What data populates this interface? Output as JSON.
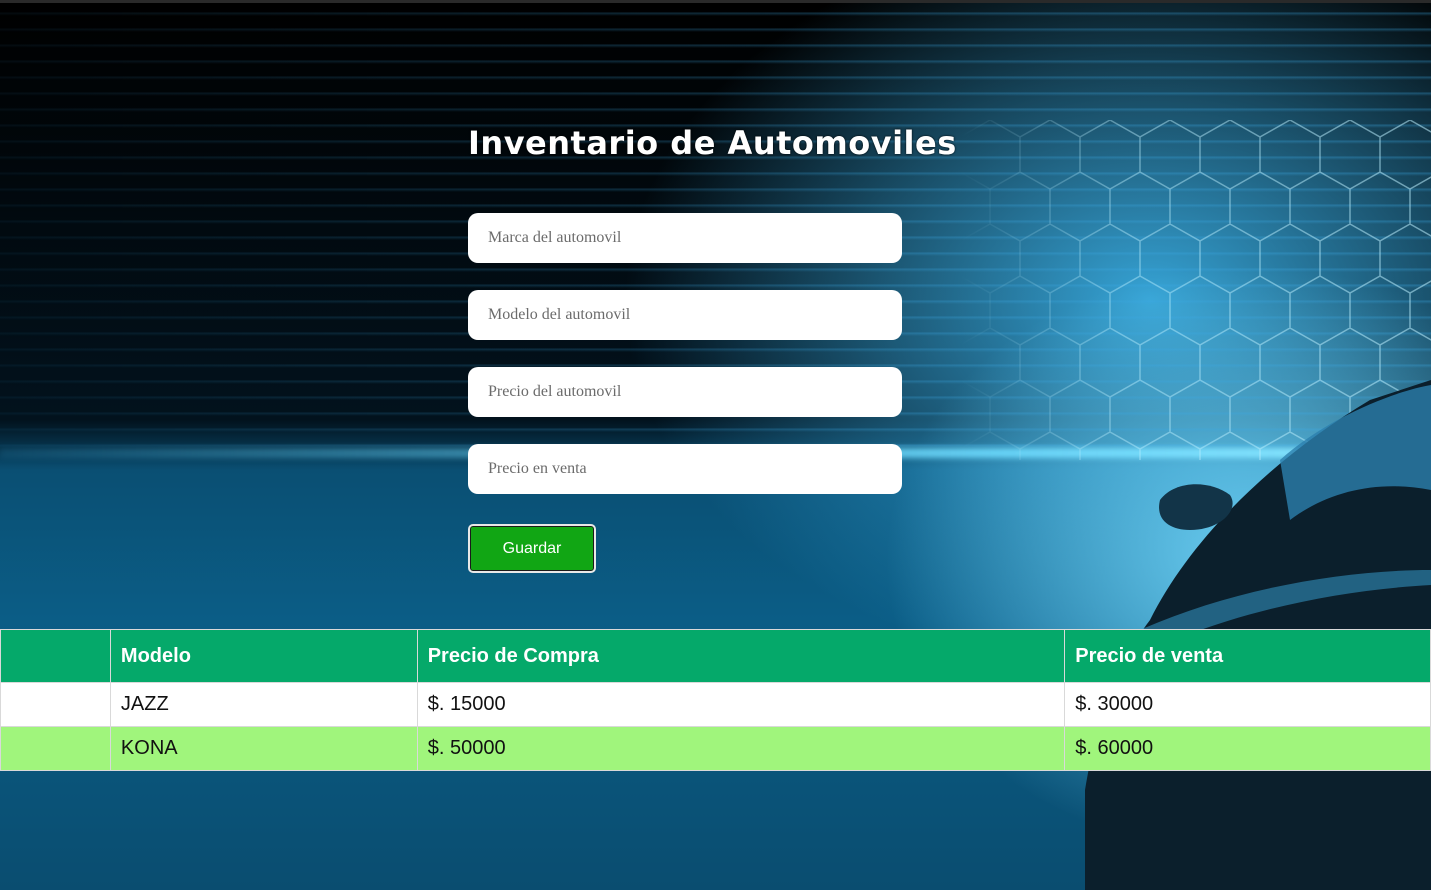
{
  "page": {
    "title": "Inventario de Automoviles"
  },
  "form": {
    "marca_placeholder": "Marca del automovil",
    "modelo_placeholder": "Modelo del automovil",
    "precio_placeholder": "Precio del automovil",
    "venta_placeholder": "Precio en venta",
    "save_label": "Guardar"
  },
  "table": {
    "headers": [
      "",
      "Modelo",
      "Precio de Compra",
      "Precio de venta"
    ],
    "rows": [
      {
        "marca": "",
        "modelo": "JAZZ",
        "compra": "$. 15000",
        "venta": "$. 30000"
      },
      {
        "marca": "",
        "modelo": "KONA",
        "compra": "$. 50000",
        "venta": "$. 60000"
      }
    ]
  },
  "colors": {
    "header_bg": "#05a96a",
    "row_alt_bg": "#a0f57c",
    "button_bg": "#11a614"
  },
  "background": {
    "icons": [
      "hexagon-pattern",
      "car-silhouette"
    ]
  }
}
